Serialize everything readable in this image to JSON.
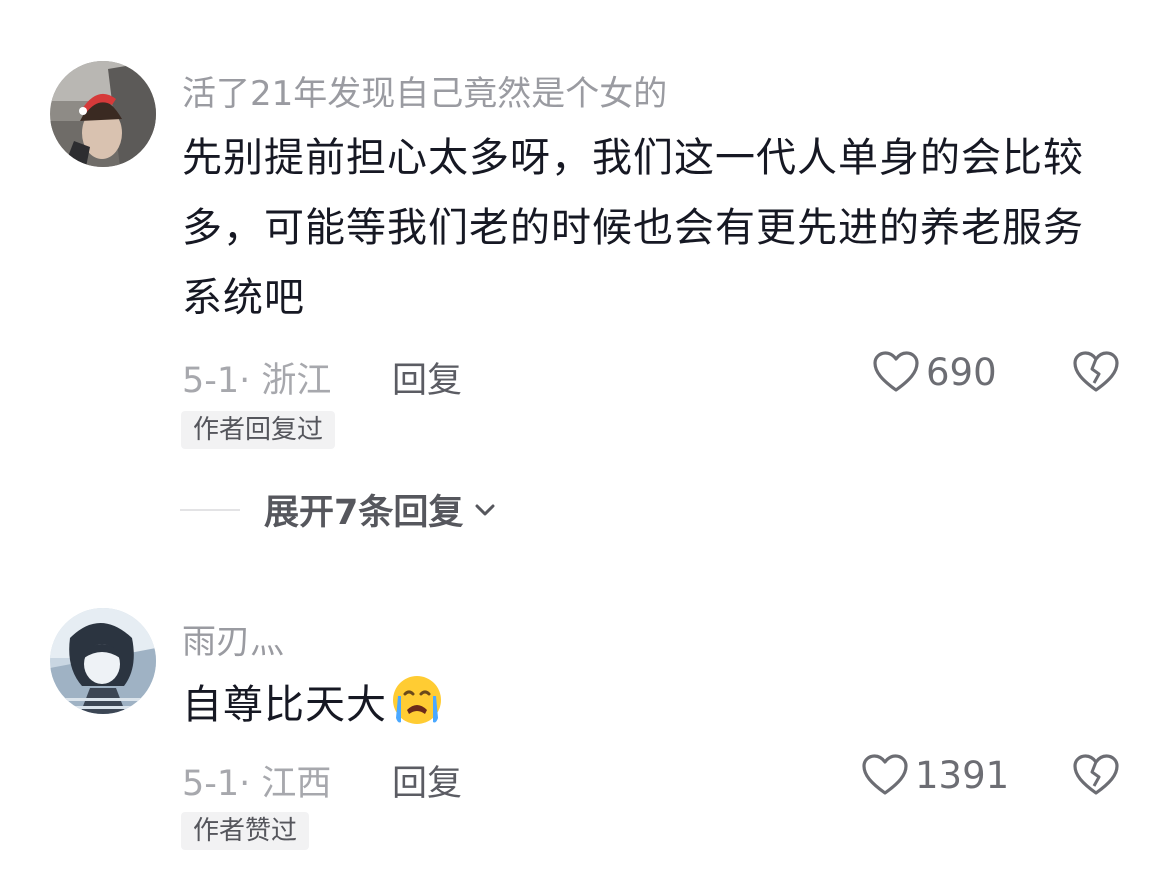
{
  "comments": [
    {
      "username": "活了21年发现自己竟然是个女的",
      "text": "先别提前担心太多呀，我们这一代人单身的会比较多，可能等我们老的时候也会有更先进的养老服务系统吧",
      "date_location": "5-1· 浙江",
      "reply_label": "回复",
      "likes": "690",
      "author_tag": "作者回复过",
      "expand_label": "展开7条回复"
    },
    {
      "username": "雨刃灬",
      "text": "自尊比天大",
      "emoji": "loudly-crying-face-icon",
      "date_location": "5-1· 江西",
      "reply_label": "回复",
      "likes": "1391",
      "author_tag": "作者赞过"
    }
  ],
  "colors": {
    "text": "#161823",
    "secondary": "#9a9ba1",
    "tag_bg": "#f2f2f3"
  }
}
